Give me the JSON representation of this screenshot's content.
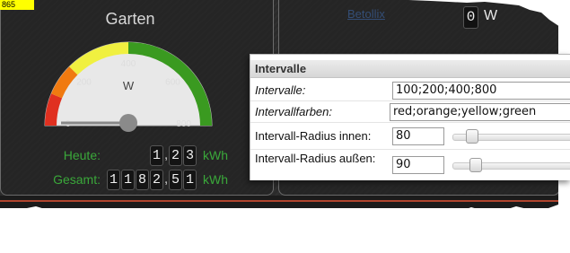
{
  "widget_id": "865",
  "garten": {
    "title": "Garten",
    "gauge": {
      "unit": "W",
      "min": 0,
      "max": 800,
      "value": 0,
      "ticks": [
        "0",
        "200",
        "400",
        "600",
        "800"
      ],
      "colors": [
        "#e03020",
        "#f07a10",
        "#f0f040",
        "#3a9a20"
      ]
    },
    "heute": {
      "label": "Heute:",
      "digits": [
        "1",
        ",",
        "2",
        "3"
      ],
      "unit": "kWh"
    },
    "gesamt": {
      "label": "Gesamt:",
      "digits": [
        "1",
        "1",
        "8",
        "2",
        ",",
        "5",
        "1"
      ],
      "unit": "kWh"
    }
  },
  "right_widget": {
    "link_text": "Betollix",
    "power_digit": "0",
    "power_unit": "W"
  },
  "panel": {
    "title": "Intervalle",
    "rows": {
      "intervalle": {
        "label": "Intervalle:",
        "value": "100;200;400;800"
      },
      "farben": {
        "label": "Intervallfarben:",
        "value": "red;orange;yellow;green"
      },
      "radius_innen": {
        "label": "Intervall-Radius innen:",
        "value": "80",
        "slider_level": 0.13
      },
      "radius_aussen": {
        "label": "Intervall-Radius außen:",
        "value": "90",
        "slider_level": 0.16
      }
    }
  }
}
